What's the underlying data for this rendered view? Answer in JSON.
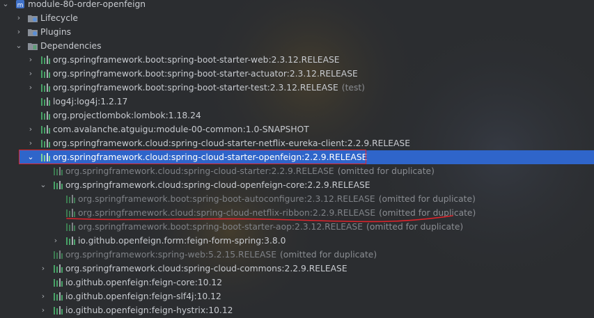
{
  "tree": {
    "root": {
      "label": "module-80-order-openfeign",
      "icon": "maven-module-icon"
    },
    "lifecycle": {
      "label": "Lifecycle",
      "icon": "lifecycle-folder-icon"
    },
    "plugins": {
      "label": "Plugins",
      "icon": "plugins-folder-icon"
    },
    "dependencies": {
      "label": "Dependencies",
      "icon": "dependencies-folder-icon"
    },
    "items": [
      {
        "text": "org.springframework.boot:spring-boot-starter-web:2.3.12.RELEASE",
        "suffix": ""
      },
      {
        "text": "org.springframework.boot:spring-boot-starter-actuator:2.3.12.RELEASE",
        "suffix": ""
      },
      {
        "text": "org.springframework.boot:spring-boot-starter-test:2.3.12.RELEASE",
        "suffix": "(test)"
      },
      {
        "text": "log4j:log4j:1.2.17",
        "suffix": ""
      },
      {
        "text": "org.projectlombok:lombok:1.18.24",
        "suffix": ""
      },
      {
        "text": "com.avalanche.atguigu:module-00-common:1.0-SNAPSHOT",
        "suffix": ""
      },
      {
        "text": "org.springframework.cloud:spring-cloud-starter-netflix-eureka-client:2.2.9.RELEASE",
        "suffix": ""
      },
      {
        "text": "org.springframework.cloud:spring-cloud-starter-openfeign:2.2.9.RELEASE",
        "suffix": ""
      },
      {
        "text": "org.springframework.cloud:spring-cloud-starter:2.2.9.RELEASE",
        "suffix": "(omitted for duplicate)"
      },
      {
        "text": "org.springframework.cloud:spring-cloud-openfeign-core:2.2.9.RELEASE",
        "suffix": ""
      },
      {
        "text": "org.springframework.boot:spring-boot-autoconfigure:2.3.12.RELEASE",
        "suffix": "(omitted for duplicate)"
      },
      {
        "text": "org.springframework.cloud:spring-cloud-netflix-ribbon:2.2.9.RELEASE",
        "suffix": "(omitted for duplicate)"
      },
      {
        "text": "org.springframework.boot:spring-boot-starter-aop:2.3.12.RELEASE",
        "suffix": "(omitted for duplicate)"
      },
      {
        "text": "io.github.openfeign.form:feign-form-spring:3.8.0",
        "suffix": ""
      },
      {
        "text": "org.springframework:spring-web:5.2.15.RELEASE",
        "suffix": "(omitted for duplicate)"
      },
      {
        "text": "org.springframework.cloud:spring-cloud-commons:2.2.9.RELEASE",
        "suffix": ""
      },
      {
        "text": "io.github.openfeign:feign-core:10.12",
        "suffix": ""
      },
      {
        "text": "io.github.openfeign:feign-slf4j:10.12",
        "suffix": ""
      },
      {
        "text": "io.github.openfeign:feign-hystrix:10.12",
        "suffix": ""
      }
    ]
  },
  "colors": {
    "background": "#2b2d30",
    "selection": "#2f65ca",
    "annotation_red": "#e0232b",
    "library_icon_green": "#48a267"
  }
}
